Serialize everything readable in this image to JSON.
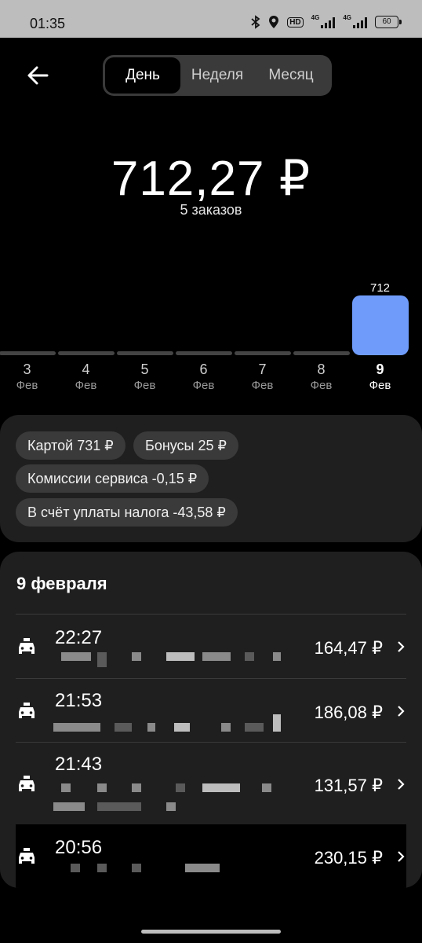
{
  "status_bar": {
    "time": "01:35",
    "hd_label": "HD",
    "net1": "4G",
    "net2": "4G",
    "battery": "60"
  },
  "header": {
    "back_icon": "arrow-left-icon",
    "tabs": [
      {
        "label": "День",
        "active": true
      },
      {
        "label": "Неделя",
        "active": false
      },
      {
        "label": "Месяц",
        "active": false
      }
    ]
  },
  "summary": {
    "amount": "712,27 ₽",
    "orders": "5 заказов"
  },
  "chart_data": {
    "type": "bar",
    "categories": [
      "3",
      "4",
      "5",
      "6",
      "7",
      "8",
      "9"
    ],
    "category_sublabels": [
      "Фев",
      "Фев",
      "Фев",
      "Фев",
      "Фев",
      "Фев",
      "Фев"
    ],
    "values": [
      0,
      0,
      0,
      0,
      0,
      0,
      712
    ],
    "data_labels": [
      "",
      "",
      "",
      "",
      "",
      "",
      "712"
    ],
    "selected_index": 6,
    "colors": {
      "bar": "#6f9cfb",
      "empty": "#444444"
    }
  },
  "breakdown": {
    "chips": [
      "Картой 731 ₽",
      "Бонусы 25 ₽",
      "Комиссии сервиса -0,15 ₽",
      "В счёт уплаты налога -43,58 ₽"
    ]
  },
  "orders_list": {
    "date_title": "9 февраля",
    "items": [
      {
        "time": "22:27",
        "price": "164,47 ₽",
        "icon": "taxi-car-icon"
      },
      {
        "time": "21:53",
        "price": "186,08 ₽",
        "icon": "taxi-car-icon"
      },
      {
        "time": "21:43",
        "price": "131,57 ₽",
        "icon": "taxi-car-icon"
      },
      {
        "time": "20:56",
        "price": "230,15 ₽",
        "icon": "taxi-car-icon"
      }
    ]
  }
}
